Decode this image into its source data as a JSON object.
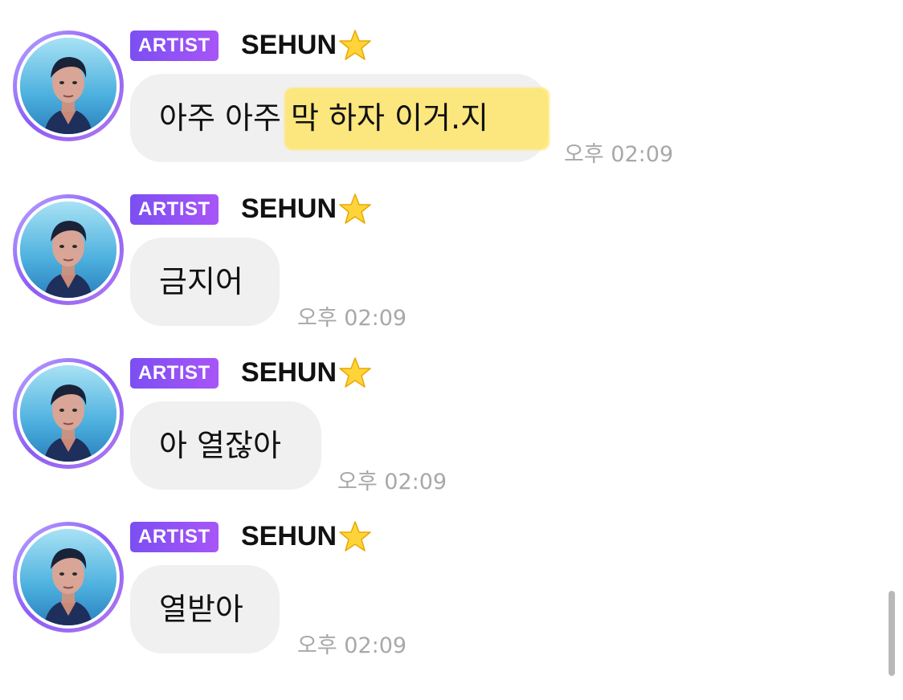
{
  "messages": [
    {
      "badge": "ARTIST",
      "sender": "SEHUN",
      "text": "아주 아주 막 하자 이거.지",
      "time": "오후 02:09",
      "highlighted": true
    },
    {
      "badge": "ARTIST",
      "sender": "SEHUN",
      "text": "금지어",
      "time": "오후 02:09",
      "highlighted": false
    },
    {
      "badge": "ARTIST",
      "sender": "SEHUN",
      "text": "아 열잖아",
      "time": "오후 02:09",
      "highlighted": false
    },
    {
      "badge": "ARTIST",
      "sender": "SEHUN",
      "text": "열받아",
      "time": "오후 02:09",
      "highlighted": false
    }
  ],
  "icons": {
    "sender_emoji": "star-icon",
    "avatar": "profile-photo"
  },
  "colors": {
    "badge_gradient_start": "#7b4ff2",
    "badge_gradient_end": "#a855f7",
    "bubble_bg": "#f0f0f0",
    "highlight": "#ffe566",
    "timestamp": "#a8a8a8"
  }
}
